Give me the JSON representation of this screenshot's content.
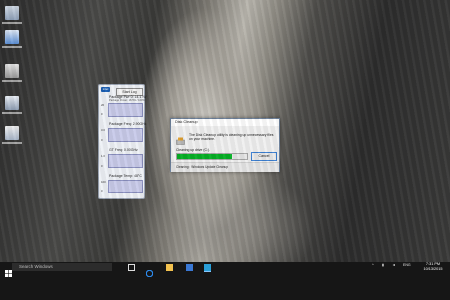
{
  "gadget": {
    "logo": "intel",
    "start_log_button": "Start Log",
    "sections": [
      {
        "title": "Package Pwr 0: 14.17W",
        "subtitle": "Package Power: 18.5% / 100W",
        "scale_top": "20",
        "scale_bottom": "0"
      },
      {
        "title": "Package Freq: 2.90GHz",
        "subtitle": "",
        "scale_top": "3.0",
        "scale_bottom": "0"
      },
      {
        "title": "GT Freq: 0.00GHz",
        "subtitle": "",
        "scale_top": "1.0",
        "scale_bottom": "0"
      },
      {
        "title": "Package Temp: 48°C",
        "subtitle": "",
        "scale_top": "100",
        "scale_bottom": "0"
      }
    ]
  },
  "dialog": {
    "title": "Disk Cleanup",
    "message": "The Disk Cleanup utility is cleaning up unnecessary files on your machine.",
    "status": "Cleaning up drive (C:).",
    "progress": 0.78,
    "cancel_label": "Cancel",
    "cleaning_label": "Cleaning:",
    "cleaning_item": "Windows Update Cleanup",
    "accent_color": "#06b025"
  },
  "taskbar": {
    "search_placeholder": "Search Windows",
    "clock_time": "7:31 PM",
    "clock_date": "10/13/2015",
    "language": "ENG"
  }
}
